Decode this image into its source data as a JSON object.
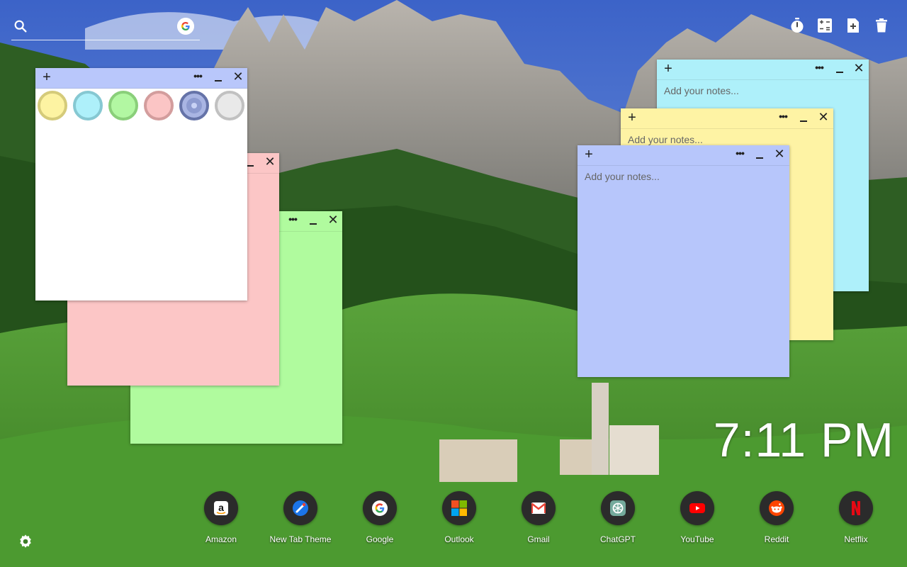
{
  "search": {
    "placeholder": ""
  },
  "notes": [
    {
      "placeholder": "Add your notes...",
      "color": "#aef0fa"
    },
    {
      "placeholder": "Add your notes...",
      "color": "#fef3a4"
    },
    {
      "placeholder": "Add your notes...",
      "color": "#b7c6fb"
    },
    {
      "color": "#b0fb9e"
    },
    {
      "color": "#fcc6c6"
    },
    {
      "color": "#ffffff"
    }
  ],
  "palette": [
    "#fdf3a2",
    "#aef0fa",
    "#b2f7a2",
    "#fbc5c5",
    "#8d9bd0",
    "#e9e9e9"
  ],
  "clock": "7:11 PM",
  "apps": [
    {
      "label": "Amazon",
      "icon": "amazon-icon"
    },
    {
      "label": "New Tab Theme",
      "icon": "new-tab-theme-icon"
    },
    {
      "label": "Google",
      "icon": "google-icon"
    },
    {
      "label": "Outlook",
      "icon": "outlook-icon"
    },
    {
      "label": "Gmail",
      "icon": "gmail-icon"
    },
    {
      "label": "ChatGPT",
      "icon": "chatgpt-icon"
    },
    {
      "label": "YouTube",
      "icon": "youtube-icon"
    },
    {
      "label": "Reddit",
      "icon": "reddit-icon"
    },
    {
      "label": "Netflix",
      "icon": "netflix-icon"
    }
  ],
  "toolbar": {
    "icons": [
      "timer-icon",
      "calculator-icon",
      "add-note-icon",
      "trash-icon"
    ]
  }
}
